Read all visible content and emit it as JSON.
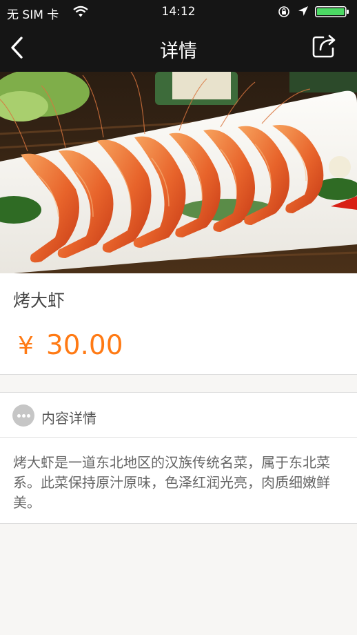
{
  "status_bar": {
    "carrier": "无 SIM 卡",
    "time": "14:12",
    "icons": [
      "wifi-icon",
      "orientation-lock-icon",
      "location-arrow-icon",
      "battery-icon"
    ],
    "battery_color": "#4cd964"
  },
  "nav": {
    "title": "详情",
    "back_icon": "chevron-left-icon",
    "share_icon": "share-icon"
  },
  "dish": {
    "photo": "grilled-shrimp-photo",
    "name": "烤大虾",
    "currency": "¥",
    "price": "30.00"
  },
  "details": {
    "heading": "内容详情",
    "heading_icon": "more-dots-icon",
    "description": "烤大虾是一道东北地区的汉族传统名菜，属于东北菜系。此菜保持原汁原味，色泽红润光亮，肉质细嫩鲜美。"
  },
  "colors": {
    "bar_background": "#151515",
    "price_accent": "#ff7a14",
    "page_background": "#f7f6f4"
  }
}
